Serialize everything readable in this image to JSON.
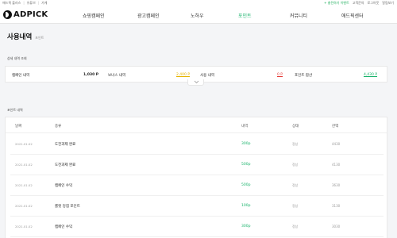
{
  "topbar": {
    "links": [
      "애드픽 플러스",
      "유튜브",
      "가게"
    ],
    "charge": "+ 충전하기 이벤트",
    "right_links": [
      "고객문의",
      "로그아웃",
      "알림보기"
    ]
  },
  "header": {
    "logo": "ADPICK",
    "nav": [
      "쇼핑캠페인",
      "광고캠페인",
      "노하우",
      "포인트",
      "커뮤니티",
      "애드픽센터"
    ],
    "active_index": 3
  },
  "page": {
    "title": "사용내역",
    "subtitle": "포인트"
  },
  "summary_section": {
    "label": "상세 내역 조회",
    "items": [
      {
        "label": "캠페인 내역",
        "value": "1,030 P"
      },
      {
        "label": "보너스 내역",
        "value": "2,400 P"
      },
      {
        "label": "사용 내역",
        "value": "0 P"
      },
      {
        "label": "포인트 합산",
        "value": "4,430 P"
      }
    ]
  },
  "history_section": {
    "label": "포인트 내역",
    "columns": [
      "날짜",
      "종류",
      "내역",
      "상태",
      "잔액"
    ],
    "rows": [
      {
        "date": "2021.01.02",
        "category": "도전과제 완료",
        "amount": "300p",
        "status": "정상",
        "balance": "4430"
      },
      {
        "date": "2021.01.02",
        "category": "도전과제 완료",
        "amount": "500p",
        "status": "정상",
        "balance": "4130"
      },
      {
        "date": "2021.01.02",
        "category": "캠페인 수익",
        "amount": "500p",
        "status": "정상",
        "balance": "3630"
      },
      {
        "date": "2021.01.02",
        "category": "룰렛 당첨 포인트",
        "amount": "100p",
        "status": "정상",
        "balance": "3130"
      },
      {
        "date": "2021.01.02",
        "category": "캠페인 수익",
        "amount": "300p",
        "status": "정상",
        "balance": "3030"
      }
    ]
  },
  "colors": {
    "accent": "#19b36b",
    "bonus": "#e6b400",
    "used": "#e53935"
  }
}
